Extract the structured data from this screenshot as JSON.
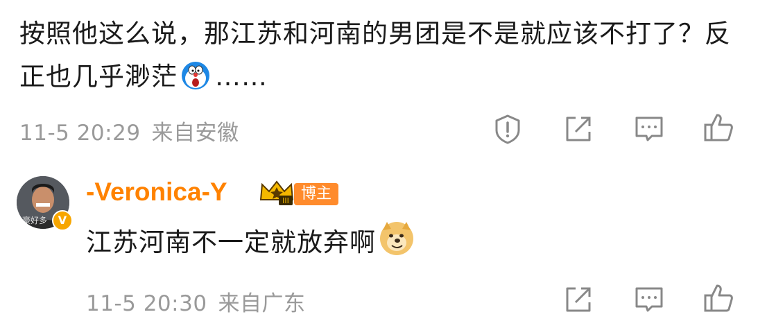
{
  "comment": {
    "text_part1": "按照他这么说，那江苏和河南的男团是不是就应该不打了？反正也几乎渺茫",
    "emoji": "doraemon-emoji",
    "text_part2": "……",
    "time": "11-5 20:29",
    "location": "来自安徽",
    "actions": [
      "report-icon",
      "share-icon",
      "comment-icon",
      "like-icon"
    ]
  },
  "reply": {
    "username": "-Veronica-Y",
    "badge": "博主",
    "avatar_caption": "豪好多",
    "verified_mark": "V",
    "text": "江苏河南不一定就放弃啊",
    "emoji": "doge-emoji",
    "time": "11-5 20:30",
    "location": "来自广东",
    "actions": [
      "share-icon",
      "comment-icon",
      "like-icon"
    ]
  },
  "colors": {
    "username": "#ff8200",
    "meta": "#9a9a9a",
    "tag": "#ff8b2c"
  }
}
